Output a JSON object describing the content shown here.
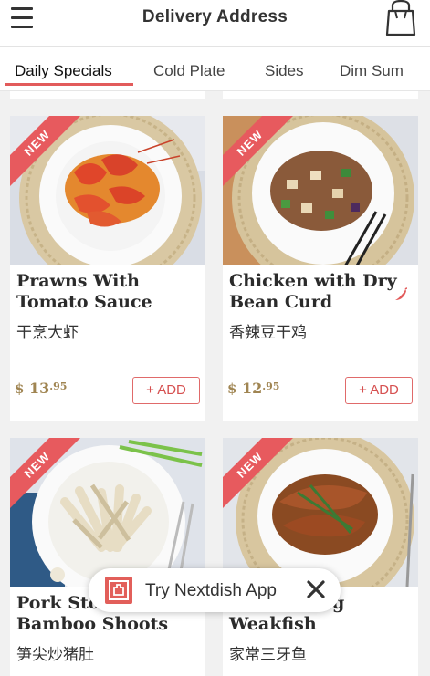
{
  "header": {
    "title": "Delivery Address",
    "menu_icon": "hamburger-menu-icon",
    "bag_icon": "shopping-bag-icon"
  },
  "tabs": [
    {
      "label": "Daily Specials",
      "active": true
    },
    {
      "label": "Cold Plate",
      "active": false
    },
    {
      "label": "Sides",
      "active": false
    },
    {
      "label": "Dim Sum",
      "active": false
    }
  ],
  "colors": {
    "accent": "#e25b5b",
    "badge": "#e75a5e",
    "price": "#a08552"
  },
  "dishes": [
    {
      "badge": "NEW",
      "name": "Prawns With Tomato Sauce",
      "name_cn": "干烹大虾",
      "price_dollar": "$",
      "price_whole": "13",
      "price_cents": "95",
      "add_label": "+ ADD",
      "spicy": false
    },
    {
      "badge": "NEW",
      "name": "Chicken with Dry Bean Curd",
      "name_cn": "香辣豆干鸡",
      "price_dollar": "$",
      "price_whole": "12",
      "price_cents": "95",
      "add_label": "+ ADD",
      "spicy": true
    },
    {
      "badge": "NEW",
      "name": "Pork Stomach Bamboo Shoots",
      "name_visible": "Pork Sto",
      "name_line2": "Bamboo Shoots",
      "name_cn": "笋尖炒猪肚"
    },
    {
      "badge": "NEW",
      "name_visible_tail": "g",
      "name_line2": "Weakfish",
      "name_cn": "家常三牙鱼"
    }
  ],
  "promo": {
    "text": "Try Nextdish App",
    "close_icon": "close-x-icon",
    "logo_icon": "nextdish-logo-icon"
  }
}
